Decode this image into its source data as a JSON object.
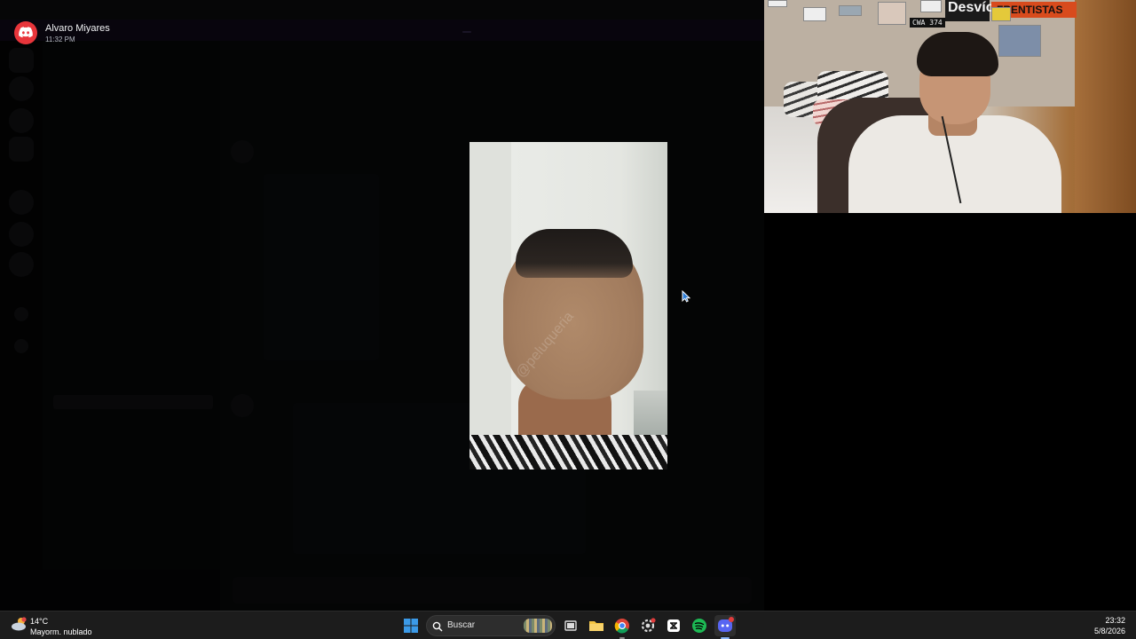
{
  "notification": {
    "sender": "Alvaro Miyares",
    "time": "11:32 PM"
  },
  "image_viewer": {
    "watermark": "@peluqueria"
  },
  "webcam": {
    "sign_1": "Desvío",
    "sign_2": "FRENTISTAS",
    "plate": "CWA 374"
  },
  "taskbar": {
    "weather_temp": "14°C",
    "weather_condition": "Mayorm. nublado",
    "search_placeholder": "Buscar",
    "time": "23:32",
    "date": "5/8/2026",
    "apps": [
      "windows-start",
      "search",
      "widgets",
      "file-explorer",
      "folder",
      "chrome",
      "settings",
      "capcut",
      "spotify",
      "discord"
    ]
  },
  "colors": {
    "discord_red": "#e8353b",
    "spotify_green": "#1db954",
    "discord_blurple": "#5865f2",
    "windows_blue": "#3b9ae8",
    "taskbar_bg": "#1c1c1c"
  }
}
